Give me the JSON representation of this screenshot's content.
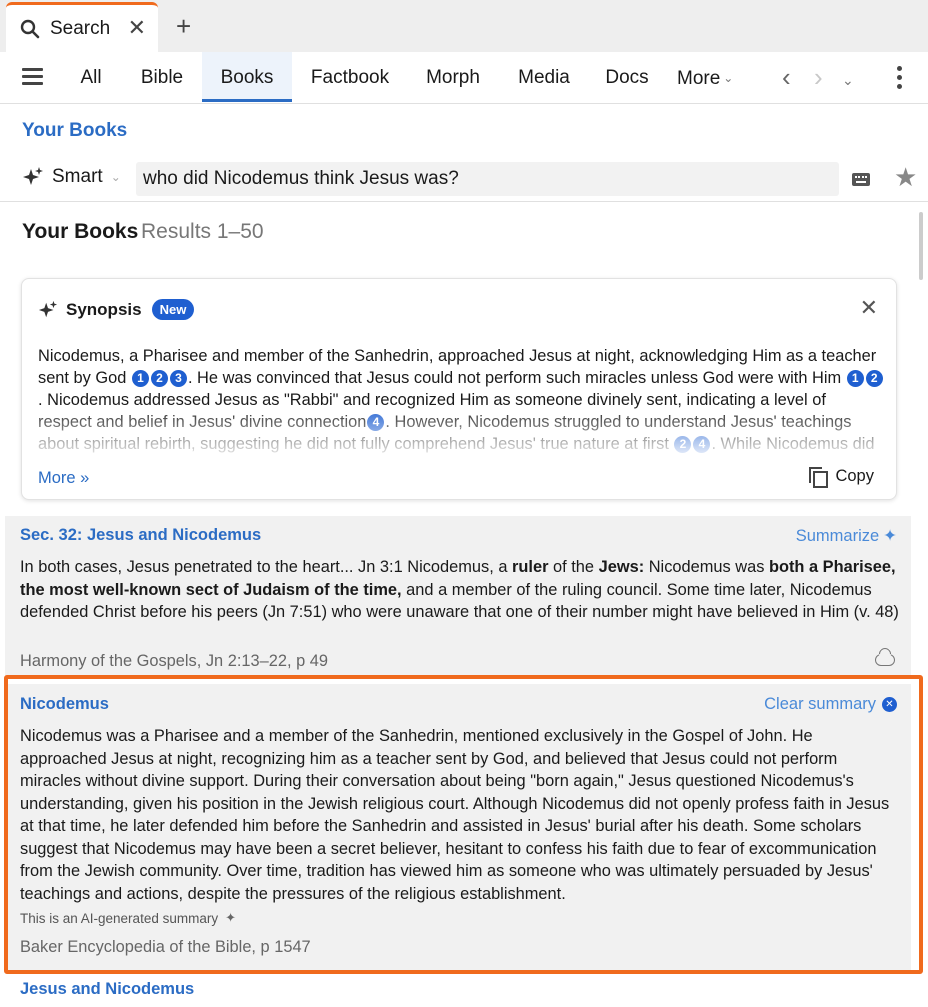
{
  "tabstrip": {
    "tab_title": "Search"
  },
  "nav": {
    "tabs": [
      "All",
      "Bible",
      "Books",
      "Factbook",
      "Morph",
      "Media",
      "Docs"
    ],
    "active": "Books",
    "more_label": "More"
  },
  "scope_heading": "Your Books",
  "search": {
    "mode_label": "Smart",
    "query": "who did Nicodemus think Jesus was?"
  },
  "results_header": {
    "title": "Your Books",
    "count": "Results 1–50"
  },
  "synopsis": {
    "title": "Synopsis",
    "badge": "New",
    "text_1": "Nicodemus, a Pharisee and member of the Sanhedrin, approached Jesus at night, acknowledging Him as a teacher sent by God",
    "text_2": ". He was convinced that Jesus could not perform such miracles unless God were with Him",
    "text_3": ". Nicodemus addressed Jesus as \"Rabbi\" and recognized Him as someone divinely sent, indicating a level of respect and belief in Jesus' divine connection",
    "text_4": ". However, Nicodemus struggled to understand Jesus' teachings about spiritual rebirth, suggesting he did not fully comprehend Jesus' true nature at first",
    "text_5": ". While Nicodemus did not",
    "citations": [
      "1",
      "2",
      "3",
      "4"
    ],
    "more_label": "More »",
    "copy_label": "Copy"
  },
  "results": [
    {
      "title": "Sec. 32: Jesus and Nicodemus",
      "action": "Summarize",
      "snippet_a": "In both cases, Jesus penetrated to the heart... Jn 3:1 Nicodemus, a ",
      "snippet_b1": "ruler",
      "snippet_c": " of the ",
      "snippet_b2": "Jews:",
      "snippet_d": " Nicodemus was ",
      "snippet_b3": "both a Pharisee, the most well-known sect of Judaism of the time,",
      "snippet_e": " and a member of the ruling council. Some time later, Nicodemus defended Christ before his peers (Jn 7:51) who were unaware that one of their number might have believed in Him (v. 48)",
      "source": "Harmony of the Gospels, Jn 2:13–22, p 49"
    },
    {
      "title": "Nicodemus",
      "action": "Clear summary",
      "summary": "Nicodemus was a Pharisee and a member of the Sanhedrin, mentioned exclusively in the Gospel of John. He approached Jesus at night, recognizing him as a teacher sent by God, and believed that Jesus could not perform miracles without divine support. During their conversation about being \"born again,\" Jesus questioned Nicodemus's understanding, given his position in the Jewish religious court. Although Nicodemus did not openly profess faith in Jesus at that time, he later defended him before the Sanhedrin and assisted in Jesus' burial after his death. Some scholars suggest that Nicodemus may have been a secret believer, hesitant to confess his faith due to fear of excommunication from the Jewish community. Over time, tradition has viewed him as someone who was ultimately persuaded by Jesus' teachings and actions, despite the pressures of the religious establishment.",
      "ai_note": "This is an AI-generated summary",
      "source": "Baker Encyclopedia of the Bible, p 1547"
    },
    {
      "title": "Jesus and Nicodemus"
    }
  ],
  "colors": {
    "accent": "#2b6cc4",
    "badge": "#1f5fd0",
    "highlight": "#f06a1d",
    "result_bg": "#f1f1f1"
  },
  "icons": [
    "search-icon",
    "close-icon",
    "plus-icon",
    "menu-icon",
    "chevron-down-icon",
    "back-arrow-icon",
    "forward-arrow-icon",
    "kebab-menu-icon",
    "sparkle-icon",
    "keyboard-icon",
    "star-icon",
    "copy-icon",
    "cloud-icon",
    "clear-circle-icon"
  ]
}
